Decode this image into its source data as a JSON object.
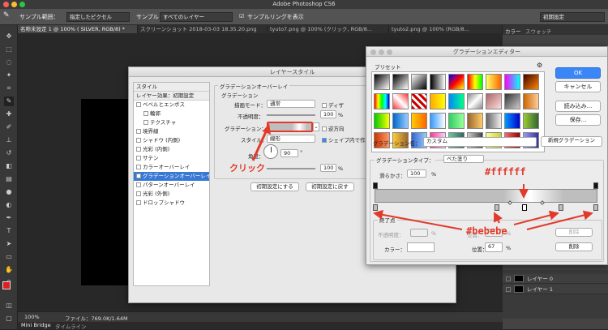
{
  "app": {
    "title": "Adobe Photoshop CS6"
  },
  "options": {
    "sample_range_label": "サンプル範囲：",
    "sample_range_value": "指定したピクセル",
    "sample_label": "サンプル：",
    "sample_value": "すべてのレイヤー",
    "ring_label": "サンプルリングを表示",
    "workspace": "初期設定"
  },
  "tabs": [
    "名称未設定 1 @ 100% ( SILVER, RGB/8) *",
    "スクリーンショット 2018-03-03 18.35.20.png",
    "tyuto7.png @ 100% (クリック, RGB/8...",
    "tyuto2.png @ 100% (RGB/8..."
  ],
  "rightpanel": {
    "tab_color": "カラー",
    "tab_swatch": "スウォッチ",
    "layers": [
      "レイヤー 0",
      "レイヤー 1"
    ]
  },
  "status": {
    "zoom": "100%",
    "file": "ファイル：769.0K/1.64M"
  },
  "bottomtabs": [
    "Mini Bridge",
    "タイムライン"
  ],
  "layerstyle": {
    "title": "レイヤースタイル",
    "list": [
      "スタイル",
      "レイヤー効果：初期設定",
      "ベベルとエンボス",
      "輪郭",
      "テクスチャ",
      "境界線",
      "シャドウ (内側)",
      "光彩 (内側)",
      "サテン",
      "カラーオーバーレイ",
      "グラデーションオーバーレイ",
      "パターンオーバーレイ",
      "光彩 (外側)",
      "ドロップシャドウ"
    ],
    "section": "グラデーションオーバーレイ",
    "subsection": "グラデーション",
    "blend_label": "描画モード：",
    "blend_value": "通常",
    "dither": "ディザ",
    "opacity_label": "不透明度：",
    "opacity_value": "100",
    "pct": "%",
    "gradient_label": "グラデーション：",
    "reverse": "逆方向",
    "style_label": "スタイル：",
    "style_value": "線形",
    "align": "シェイプ内で作成",
    "angle_label": "角度：",
    "angle_value": "90",
    "deg": "°",
    "scale_value": "100",
    "btn_default": "初期設定にする",
    "btn_reset": "初期設定に戻す"
  },
  "editor": {
    "title": "グラデーションエディター",
    "preset_label": "プリセット",
    "ok": "OK",
    "cancel": "キャンセル",
    "load": "読み込み...",
    "save": "保存...",
    "name_label": "グラデーション名：",
    "name_value": "カスタム",
    "new_btn": "新規グラデーション",
    "type_label": "グラデーションタイプ：",
    "type_value": "べた塗り",
    "smooth_label": "滑らかさ：",
    "smooth_value": "100",
    "pct": "%",
    "stops_label": "終了点",
    "opacity_label": "不透明度：",
    "color_label": "カラー：",
    "location_label": "位置：",
    "location_value": "67",
    "delete": "削除"
  },
  "annotations": {
    "click": "クリック",
    "white": "#ffffff",
    "gray": "#bebebe"
  }
}
